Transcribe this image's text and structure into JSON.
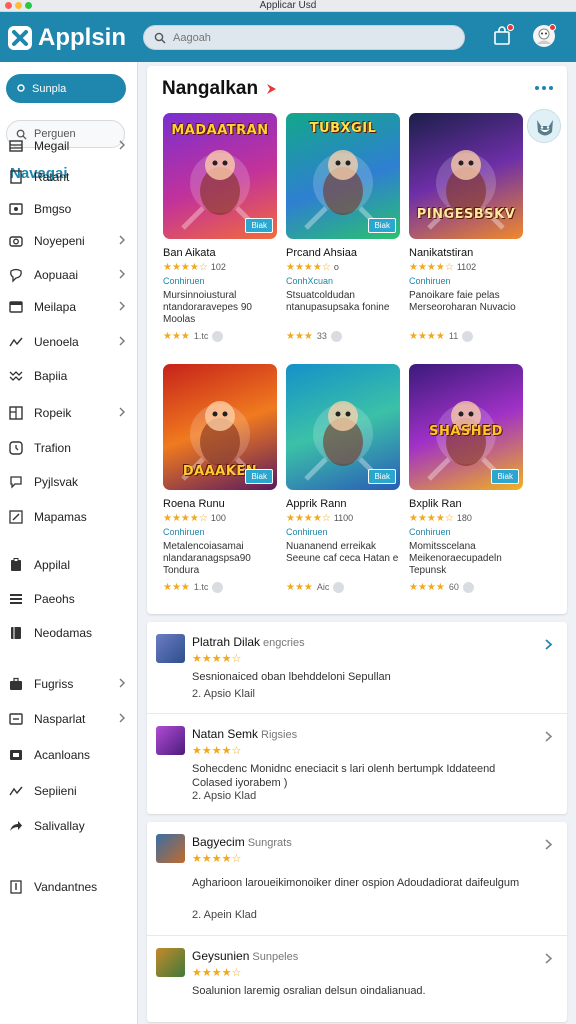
{
  "window": {
    "title": "Applicar Usd"
  },
  "header": {
    "app_name": "Applsin",
    "search_placeholder": "Aagoah",
    "colors": {
      "primary": "#1f86ad",
      "star": "#f2a81f"
    }
  },
  "sidebar": {
    "primary_button": "Sunpla",
    "search_placeholder": "Perguen",
    "heading": "Navagai",
    "items": [
      {
        "label": "Megail",
        "icon": "grid-icon",
        "chevron": true
      },
      {
        "label": "Ratant",
        "icon": "square-icon",
        "chevron": false
      },
      {
        "label": "Bmgso",
        "icon": "photo-icon",
        "chevron": false
      },
      {
        "label": "Noyepeni",
        "icon": "camera-icon",
        "chevron": true
      },
      {
        "label": "Aopuaai",
        "icon": "bubble-icon",
        "chevron": true
      },
      {
        "label": "Meilapa",
        "icon": "window-icon",
        "chevron": true
      },
      {
        "label": "Uenoela",
        "icon": "trend-icon",
        "chevron": true
      },
      {
        "label": "Bapiia",
        "icon": "wave-icon",
        "chevron": false
      },
      {
        "label": "Ropeik",
        "icon": "columns-icon",
        "chevron": true
      },
      {
        "label": "Trafion",
        "icon": "clock-icon",
        "chevron": false
      },
      {
        "label": "Pyjlsvak",
        "icon": "chat-icon",
        "chevron": false
      },
      {
        "label": "Mapamas",
        "icon": "edit-icon",
        "chevron": false
      },
      {
        "label": "Appilal",
        "icon": "clipboard-icon",
        "chevron": false
      },
      {
        "label": "Paeohs",
        "icon": "list-icon",
        "chevron": false
      },
      {
        "label": "Neodamas",
        "icon": "book-icon",
        "chevron": false
      },
      {
        "label": "Fugriss",
        "icon": "briefcase-icon",
        "chevron": true
      },
      {
        "label": "Nasparlat",
        "icon": "card-icon",
        "chevron": true
      },
      {
        "label": "Acanloans",
        "icon": "wallet-icon",
        "chevron": false
      },
      {
        "label": "Sepiieni",
        "icon": "trend-icon",
        "chevron": false
      },
      {
        "label": "Salivallay",
        "icon": "share-icon",
        "chevron": false
      },
      {
        "label": "Vandantnes",
        "icon": "note-icon",
        "chevron": false
      }
    ]
  },
  "featured": {
    "title": "Nangalkan",
    "cards": [
      {
        "art_text": "MADAATRAN",
        "badge": "Biak",
        "name": "Ban Aikata",
        "rating_value": "102",
        "developer": "Conhiruen",
        "description": "Mursinnoiustural ntandoraravepes 90 Moolas",
        "footer_count": "1.tc",
        "stars": "★★★★☆",
        "foot_stars": "★★★"
      },
      {
        "art_text": "TUBXGIL",
        "badge": "Biak",
        "name": "Prcand Ahsiaa",
        "rating_value": "o",
        "developer": "ConhXcuan",
        "description": "Stsuatcoldudan ntanupasupsaka fonine",
        "footer_count": "33",
        "stars": "★★★★☆",
        "foot_stars": "★★★"
      },
      {
        "art_text": "PINGESBSKV",
        "badge": "",
        "name": "Nanikatstiran",
        "rating_value": "1102",
        "developer": "Conhiruen",
        "description": "Panoikare faie pelas Merseoroharan Nuvacio",
        "footer_count": "11",
        "stars": "★★★★☆",
        "foot_stars": "★★★★"
      },
      {
        "art_text": "DAAAKEN",
        "badge": "Biak",
        "name": "Roena Runu",
        "rating_value": "100",
        "developer": "Conhiruen",
        "description": "Metalencoiasamai nlandaranagspsa90 Tondura",
        "footer_count": "1.tc",
        "stars": "★★★★☆",
        "foot_stars": "★★★"
      },
      {
        "art_text": "",
        "badge": "Biak",
        "name": "Apprik Rann",
        "rating_value": "1100",
        "developer": "Conhiruen",
        "description": "Nuananend erreikak Seeune caf ceca Hatan e",
        "footer_count": "Aic",
        "stars": "★★★★☆",
        "foot_stars": "★★★"
      },
      {
        "art_text": "SHASHED",
        "badge": "Biak",
        "name": "Bxplik Ran",
        "rating_value": "180",
        "developer": "Conhiruen",
        "description": "Momitsscelana Meikenoraecupadeln Tepunsk",
        "footer_count": "60",
        "stars": "★★★★☆",
        "foot_stars": "★★★★"
      }
    ]
  },
  "reviews": [
    {
      "title": "Platrah Dilak",
      "tag": "engcries",
      "stars": "★★★★☆",
      "text": "Sesnionaiced oban lbehddeloni Sepullan",
      "meta": "2. Apsio Klail"
    },
    {
      "title": "Natan Semk",
      "tag": "Rigsies",
      "stars": "★★★★☆",
      "text": "Sohecdenc Monidnc eneciacit s lari olenh bertumpk Iddateend Colased iyorabem )",
      "meta": "2. Apsio Klad"
    },
    {
      "title": "Bagyecim",
      "tag": "Sungrats",
      "stars": "★★★★☆",
      "text": "Agharioon laroueikimonoiker diner ospion Adoudadiorat daifeulgum",
      "meta": "2. Apein Klad"
    },
    {
      "title": "Geysunien",
      "tag": "Sunpeles",
      "stars": "★★★★☆",
      "text": "Soalunion laremig osralian delsun oindalianuad.",
      "meta": ""
    }
  ]
}
